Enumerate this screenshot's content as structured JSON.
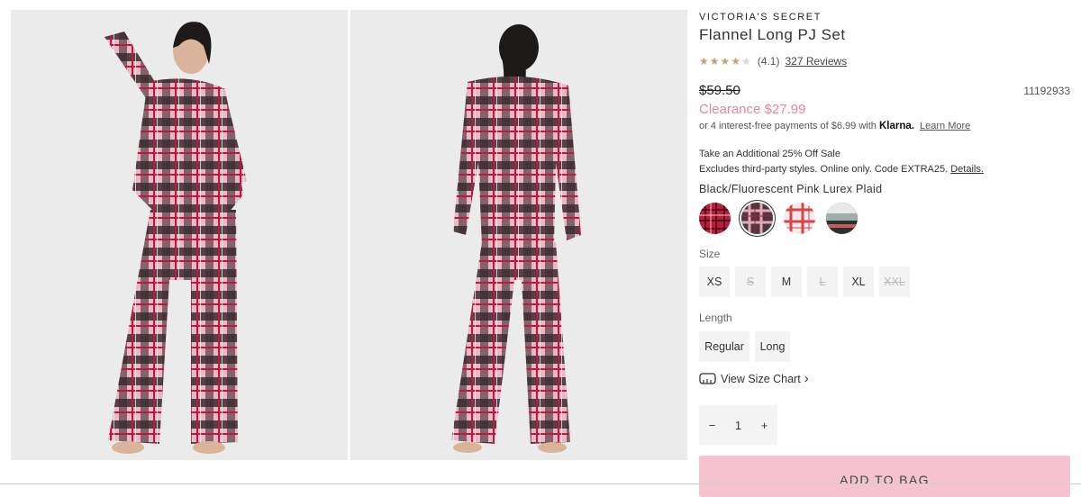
{
  "product": {
    "brand": "VICTORIA'S SECRET",
    "title": "Flannel Long PJ Set",
    "rating_value": "(4.1)",
    "rating_stars": 4.1,
    "reviews_label": "327 Reviews",
    "original_price": "$59.50",
    "sale_price": "Clearance $27.99",
    "sku": "11192933",
    "klarna_text": "or 4 interest-free payments of $6.99 with",
    "klarna_brand": "Klarna.",
    "klarna_link": "Learn More",
    "promo_line1": "Take an Additional 25% Off Sale",
    "promo_line2": "Excludes third-party styles. Online only. Code EXTRA25.",
    "promo_link": "Details.",
    "color_name": "Black/Fluorescent Pink Lurex Plaid",
    "swatches": [
      {
        "name": "red plaid",
        "base": "#b81d3a",
        "line": "#5a0a1a",
        "selected": false
      },
      {
        "name": "black pink plaid",
        "base": "#4a3a3f",
        "line": "#e6a6b6",
        "selected": true
      },
      {
        "name": "white red plaid",
        "base": "#f6eaea",
        "line": "#d8434c",
        "selected": false
      },
      {
        "name": "grey mint stripe",
        "base": "#8e9aa0",
        "line": "#2a3136",
        "selected": false
      }
    ],
    "size_label": "Size",
    "sizes": [
      {
        "label": "XS",
        "available": true
      },
      {
        "label": "S",
        "available": false
      },
      {
        "label": "M",
        "available": true
      },
      {
        "label": "L",
        "available": false
      },
      {
        "label": "XL",
        "available": true
      },
      {
        "label": "XXL",
        "available": false
      }
    ],
    "length_label": "Length",
    "lengths": [
      "Regular",
      "Long"
    ],
    "size_chart_label": "View Size Chart",
    "quantity": "1",
    "minus": "−",
    "plus": "+",
    "add_to_bag": "ADD TO BAG"
  },
  "icons": {
    "chevron": "›",
    "ruler": "ruler-icon"
  },
  "colors": {
    "sale": "#e8859a",
    "button": "#f5c2cf",
    "star": "#bfa372"
  }
}
